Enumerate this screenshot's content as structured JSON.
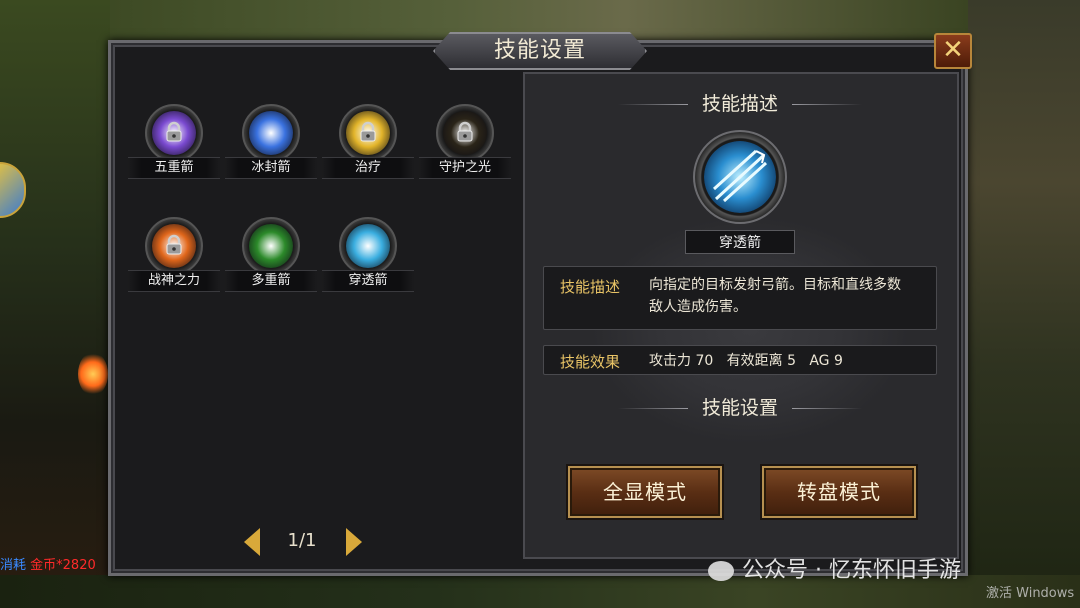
{
  "window": {
    "title": "技能设置",
    "close_label": "✕"
  },
  "skills": [
    {
      "name": "五重箭",
      "locked": true,
      "color": "#7a4ad0"
    },
    {
      "name": "冰封箭",
      "locked": false,
      "color": "#3a72e0"
    },
    {
      "name": "治疗",
      "locked": true,
      "color": "#e2b42a"
    },
    {
      "name": "守护之光",
      "locked": true,
      "color": "#2a2418"
    },
    {
      "name": "战神之力",
      "locked": true,
      "color": "#e0661a"
    },
    {
      "name": "多重箭",
      "locked": false,
      "color": "#2c8a2a"
    },
    {
      "name": "穿透箭",
      "locked": false,
      "color": "#3aaee0"
    }
  ],
  "pager": {
    "text": "1/1"
  },
  "detail": {
    "desc_heading": "技能描述",
    "skill_name": "穿透箭",
    "desc_key": "技能描述",
    "desc_line1": "向指定的目标发射弓箭。目标和直线多数",
    "desc_line2": "敌人造成伤害。",
    "effect_key": "技能效果",
    "effect_value": "攻击力 70   有效距离 5   AG 9",
    "settings_heading": "技能设置",
    "btn_full": "全显模式",
    "btn_wheel": "转盘模式"
  },
  "overlay": {
    "cost_key": "消耗",
    "cost_value": "金币*2820",
    "watermark": "公众号 · 忆东怀旧手游",
    "activate": "激活 Windows"
  }
}
